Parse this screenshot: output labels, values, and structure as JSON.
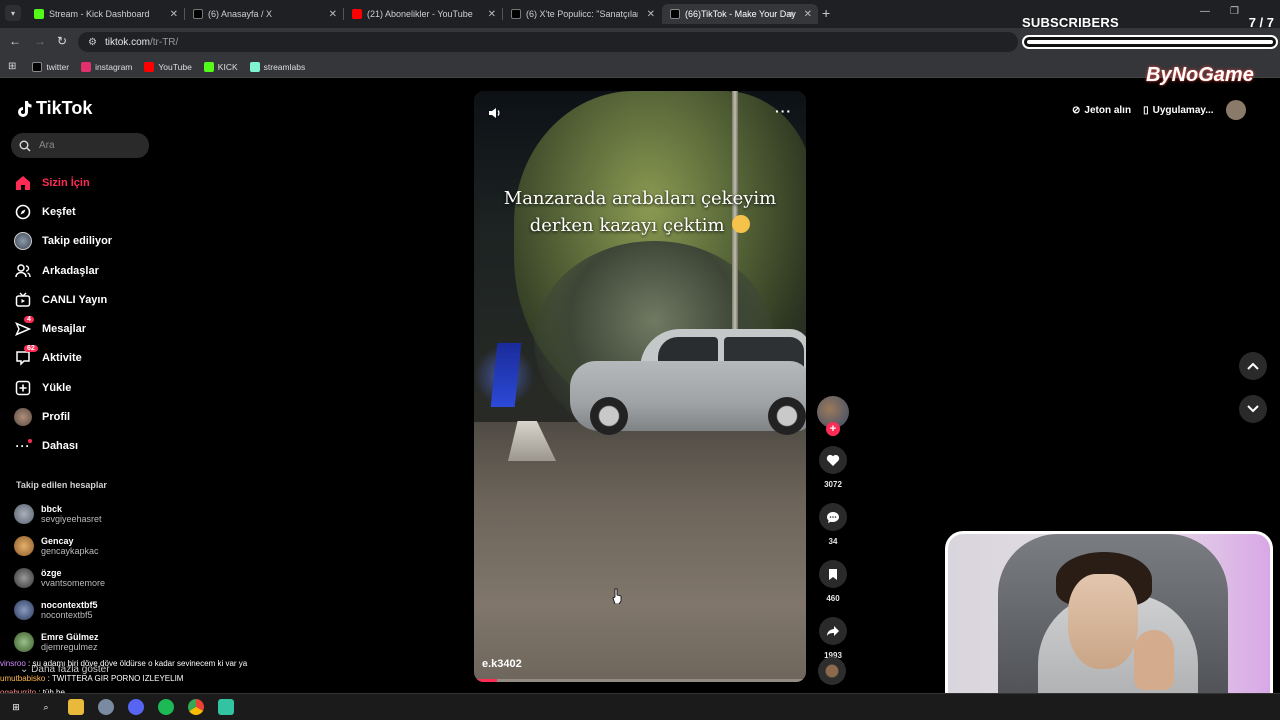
{
  "browser": {
    "tabs": [
      {
        "label": "Stream - Kick Dashboard",
        "favicon_color": "#53fc18"
      },
      {
        "label": "(6) Anasayfa / X",
        "favicon_color": "#000000"
      },
      {
        "label": "(21) Abonelikler - YouTube",
        "favicon_color": "#ff0000"
      },
      {
        "label": "(6) X'te Populicc: \"Sanatçıların y",
        "favicon_color": "#000000"
      },
      {
        "label": "(66)TikTok - Make Your Day",
        "favicon_color": "#000000"
      }
    ],
    "url": "tiktok.com",
    "url_path": "/tr-TR/",
    "bookmarks": [
      {
        "label": "twitter",
        "color": "#000000"
      },
      {
        "label": "instagram",
        "color": "#e1306c"
      },
      {
        "label": "YouTube",
        "color": "#ff0000"
      },
      {
        "label": "KICK",
        "color": "#53fc18"
      },
      {
        "label": "streamlabs",
        "color": "#80f5d2"
      }
    ]
  },
  "overlay": {
    "subscribers_label": "SUBSCRIBERS",
    "subscribers_count": "7 / 7",
    "subscribers_progress": 1.0,
    "brand": "ByNoGame"
  },
  "tiktok": {
    "logo": "TikTok",
    "search_placeholder": "Ara",
    "nav": [
      {
        "label": "Sizin İçin",
        "icon": "home-icon",
        "active": true
      },
      {
        "label": "Keşfet",
        "icon": "compass-icon"
      },
      {
        "label": "Takip ediliyor",
        "icon": "following-avatar-icon"
      },
      {
        "label": "Arkadaşlar",
        "icon": "friends-icon"
      },
      {
        "label": "CANLI Yayın",
        "icon": "live-icon"
      },
      {
        "label": "Mesajlar",
        "icon": "messages-icon",
        "badge": "4"
      },
      {
        "label": "Aktivite",
        "icon": "activity-icon",
        "badge": "62"
      },
      {
        "label": "Yükle",
        "icon": "upload-icon"
      },
      {
        "label": "Profil",
        "icon": "profile-icon"
      },
      {
        "label": "Dahası",
        "icon": "more-icon"
      }
    ],
    "following_header": "Takip edilen hesaplar",
    "following": [
      {
        "name": "bbck",
        "handle": "sevgiyeehasret",
        "color": "#6a6f7a"
      },
      {
        "name": "Gencay",
        "handle": "gencaykapkac",
        "color": "#c98a3a"
      },
      {
        "name": "özge",
        "handle": "vvantsomemore",
        "color": "#5a5a5a"
      },
      {
        "name": "nocontextbf5",
        "handle": "nocontextbf5",
        "color": "#3a4a6a"
      },
      {
        "name": "Emre Gülmez",
        "handle": "djemregulmez",
        "color": "#4a6a3a"
      }
    ],
    "show_more": "Daha fazla göster",
    "header": {
      "coins": "Jeton alın",
      "app": "Uygulamay..."
    },
    "video": {
      "caption_line1": "Manzarada arabaları çekeyim",
      "caption_line2": "derken kazayı çektim",
      "author": "e.k3402",
      "progress": 0.07
    },
    "actions": {
      "likes": "3072",
      "comments": "34",
      "saves": "460",
      "shares": "1993"
    }
  },
  "chat": [
    {
      "user": "vinsroo",
      "message": " : şu adamı biri döve döve öldürse o kadar sevinecem ki var ya"
    },
    {
      "user": "umutbabisko",
      "message": " : TWITTERA GIR PORNO IZLEYELIM"
    },
    {
      "user": "ogaburrito",
      "message": " : tüh be"
    }
  ]
}
